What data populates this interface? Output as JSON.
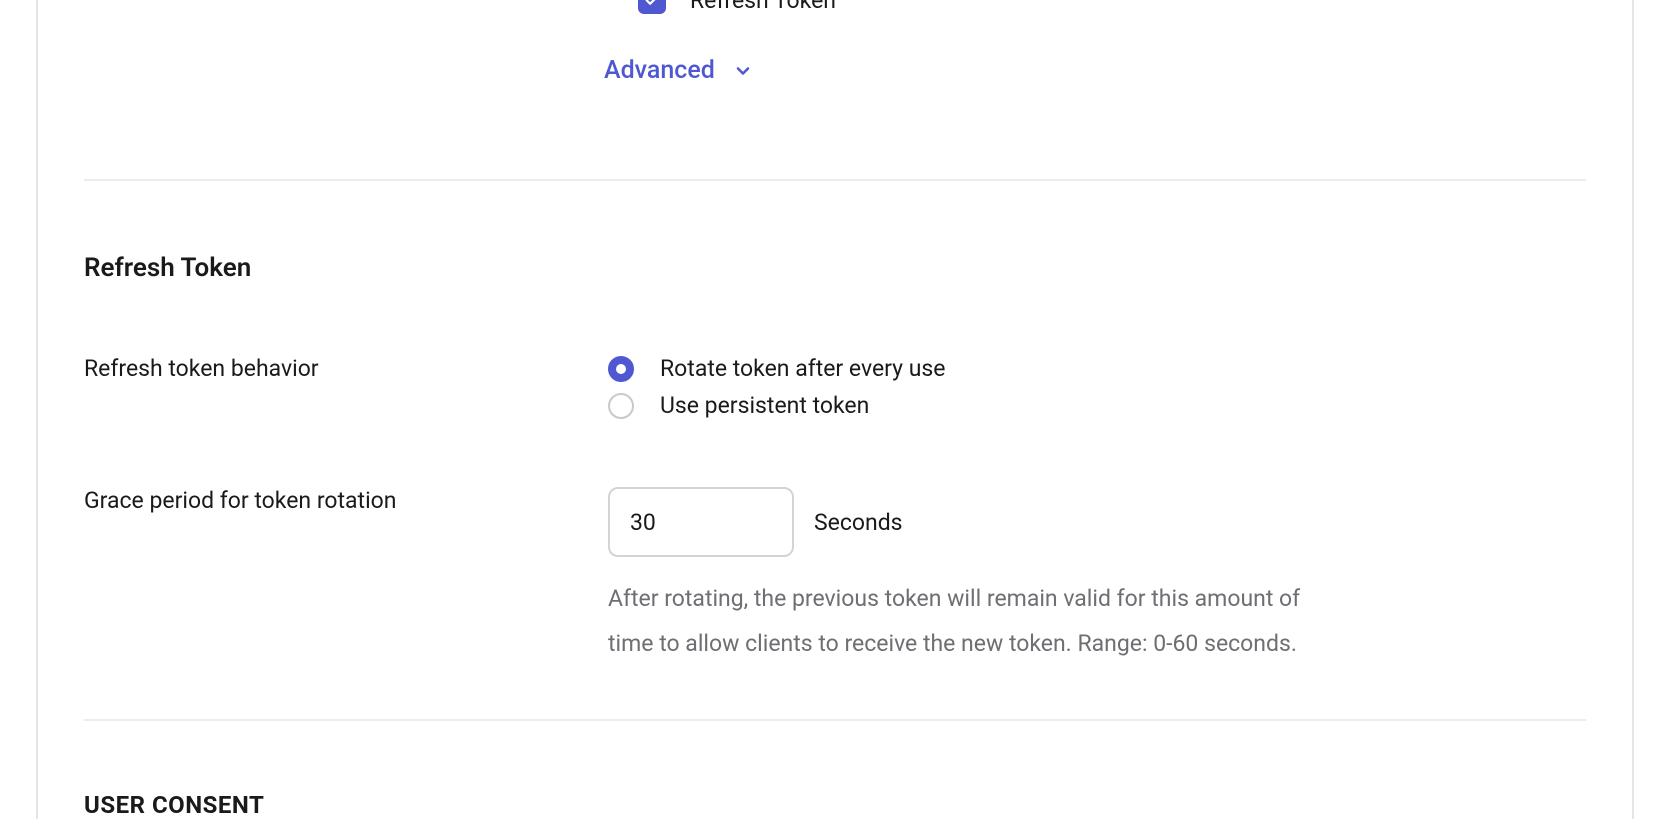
{
  "top_checkbox": {
    "label": "Refresh Token"
  },
  "advanced": {
    "label": "Advanced"
  },
  "section": {
    "title": "Refresh Token"
  },
  "refresh_behavior": {
    "label": "Refresh token behavior",
    "options": {
      "rotate": "Rotate token after every use",
      "persistent": "Use persistent token"
    }
  },
  "grace_period": {
    "label": "Grace period for token rotation",
    "value": "30",
    "unit": "Seconds",
    "helper": "After rotating, the previous token will remain valid for this amount of time to allow clients to receive the new token. Range: 0-60 seconds."
  },
  "next_section": {
    "title": "USER CONSENT"
  }
}
